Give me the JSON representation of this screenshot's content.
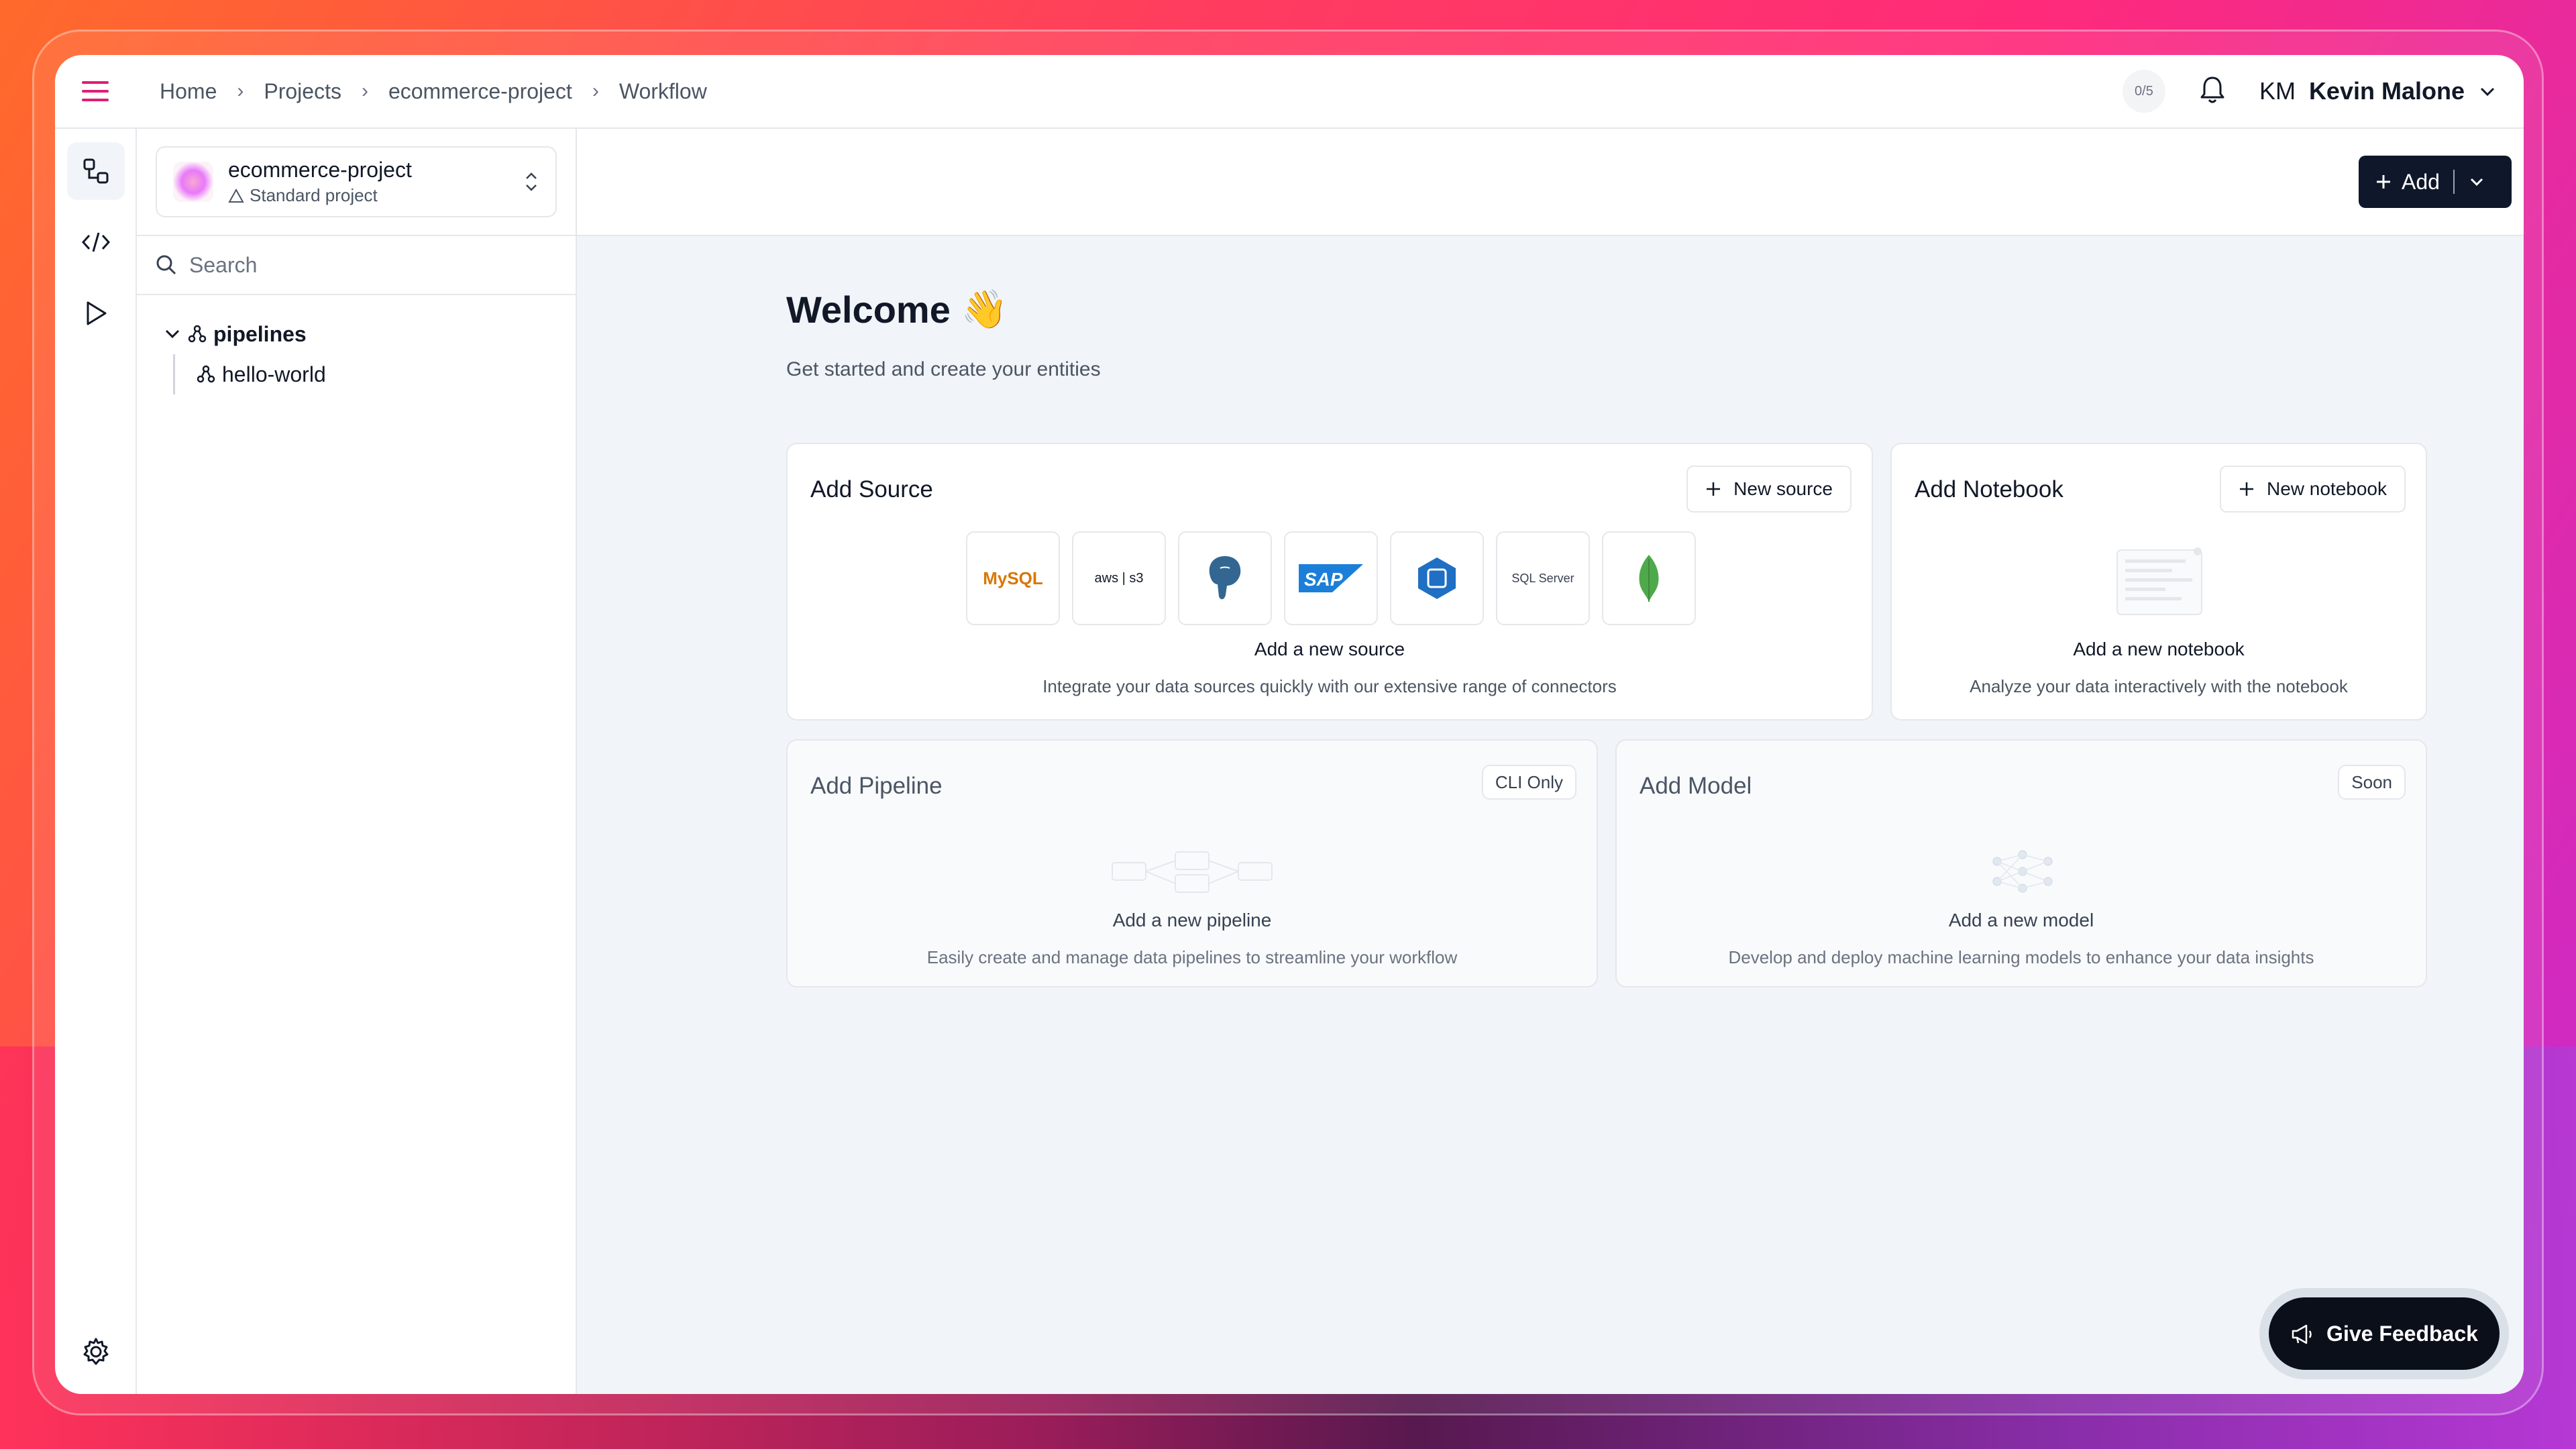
{
  "breadcrumb": [
    "Home",
    "Projects",
    "ecommerce-project",
    "Workflow"
  ],
  "header": {
    "counter": "0/5",
    "user_initials": "KM",
    "user_name": "Kevin Malone"
  },
  "project": {
    "name": "ecommerce-project",
    "type": "Standard project"
  },
  "search": {
    "placeholder": "Search"
  },
  "tree": {
    "folder": "pipelines",
    "items": [
      "hello-world"
    ]
  },
  "toolbar": {
    "add_label": "Add"
  },
  "welcome": {
    "title": "Welcome",
    "emoji": "👋",
    "subtitle": "Get started and create your entities"
  },
  "cards": {
    "source": {
      "title": "Add Source",
      "button": "New source",
      "heading": "Add a new source",
      "desc": "Integrate your data sources quickly with our extensive range of connectors",
      "connectors": [
        "MySQL",
        "aws | s3",
        "PostgreSQL",
        "SAP",
        "Azure",
        "SQL Server",
        "MongoDB"
      ]
    },
    "notebook": {
      "title": "Add Notebook",
      "button": "New notebook",
      "heading": "Add a new notebook",
      "desc": "Analyze your data interactively with the notebook"
    },
    "pipeline": {
      "title": "Add Pipeline",
      "badge": "CLI Only",
      "heading": "Add a new pipeline",
      "desc": "Easily create and manage data pipelines to streamline your workflow"
    },
    "model": {
      "title": "Add Model",
      "badge": "Soon",
      "heading": "Add a new model",
      "desc": "Develop and deploy machine learning models to enhance your data insights"
    }
  },
  "feedback": {
    "label": "Give Feedback"
  },
  "colors": {
    "accent": "#e11d74",
    "dark": "#0f172a",
    "canvas": "#f1f4f8"
  }
}
